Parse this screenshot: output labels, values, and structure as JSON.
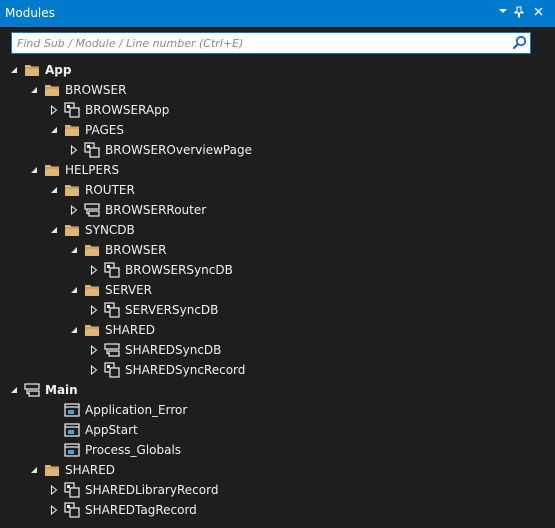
{
  "window": {
    "title": "Modules"
  },
  "search": {
    "placeholder": "Find Sub / Module / Line number (Ctrl+E)",
    "value": ""
  },
  "tree": [
    {
      "label": "App",
      "icon": "folder-icon",
      "expanded": true,
      "bold": true
    },
    {
      "label": "BROWSER",
      "icon": "folder-icon",
      "expanded": true
    },
    {
      "label": "BROWSERApp",
      "icon": "class-module-icon",
      "expanded": false
    },
    {
      "label": "PAGES",
      "icon": "folder-icon",
      "expanded": true
    },
    {
      "label": "BROWSEROverviewPage",
      "icon": "class-module-icon",
      "expanded": false
    },
    {
      "label": "HELPERS",
      "icon": "folder-icon",
      "expanded": true
    },
    {
      "label": "ROUTER",
      "icon": "folder-icon",
      "expanded": true
    },
    {
      "label": "BROWSERRouter",
      "icon": "module-icon",
      "expanded": false
    },
    {
      "label": "SYNCDB",
      "icon": "folder-icon",
      "expanded": true
    },
    {
      "label": "BROWSER",
      "icon": "folder-icon",
      "expanded": true
    },
    {
      "label": "BROWSERSyncDB",
      "icon": "class-module-icon",
      "expanded": false
    },
    {
      "label": "SERVER",
      "icon": "folder-icon",
      "expanded": true
    },
    {
      "label": "SERVERSyncDB",
      "icon": "class-module-icon",
      "expanded": false
    },
    {
      "label": "SHARED",
      "icon": "folder-icon",
      "expanded": true
    },
    {
      "label": "SHAREDSyncDB",
      "icon": "module-icon",
      "expanded": false
    },
    {
      "label": "SHAREDSyncRecord",
      "icon": "class-module-icon",
      "expanded": false
    },
    {
      "label": "Main",
      "icon": "module-icon",
      "expanded": true,
      "bold": true
    },
    {
      "label": "Application_Error",
      "icon": "sub-icon"
    },
    {
      "label": "AppStart",
      "icon": "sub-icon"
    },
    {
      "label": "Process_Globals",
      "icon": "sub-icon"
    },
    {
      "label": "SHARED",
      "icon": "folder-icon",
      "expanded": true
    },
    {
      "label": "SHAREDLibraryRecord",
      "icon": "class-module-icon",
      "expanded": false
    },
    {
      "label": "SHAREDTagRecord",
      "icon": "class-module-icon",
      "expanded": false
    }
  ],
  "colors": {
    "accent": "#007acc",
    "background": "#1e1e1e",
    "folder": "#dcb67a",
    "text": "#f1f1f1"
  }
}
